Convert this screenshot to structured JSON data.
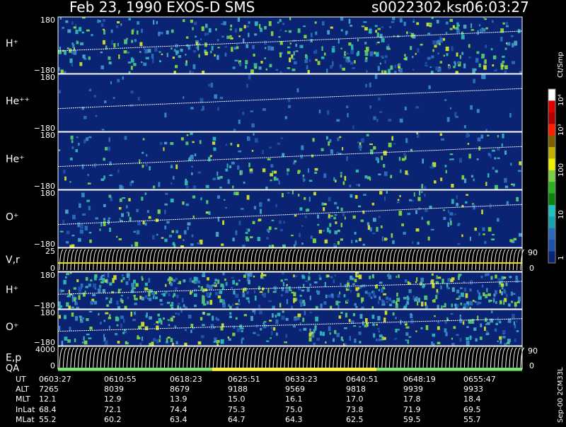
{
  "header": {
    "title": "Feb 23, 1990   EXOS-D SMS",
    "file": "s0022302.ksr",
    "time": "06:03:27"
  },
  "colors": {
    "background": "#000000",
    "panel_base": "#0a2473",
    "grid_line": "#ffffff",
    "qa_green": "#44c83a",
    "qa_yellow": "#f0e000"
  },
  "chart_data": {
    "type": "heatmap",
    "title": "Feb 23, 1990   EXOS-D SMS",
    "colorbar": {
      "label": "Ct/Smp",
      "tick_labels": [
        "10⁴",
        "10³",
        "100",
        "10",
        "1"
      ]
    },
    "panels": [
      {
        "id": "h-plus-1",
        "label": "H⁺",
        "y_top": "180",
        "y_bottom": "−180",
        "activity": 0.7
      },
      {
        "id": "he-plus-plus",
        "label": "He⁺⁺",
        "y_top": "180",
        "y_bottom": "−180",
        "activity": 0.05
      },
      {
        "id": "he-plus",
        "label": "He⁺",
        "y_top": "180",
        "y_bottom": "−180",
        "activity": 0.35
      },
      {
        "id": "o-plus-1",
        "label": "O⁺",
        "y_top": "180",
        "y_bottom": "−180",
        "activity": 0.4
      },
      {
        "id": "v-r",
        "label": "V,r",
        "y_top": "25",
        "y_bottom": "0",
        "right_top": "90",
        "right_bottom": "0",
        "activity": 0
      },
      {
        "id": "h-plus-2",
        "label": "H⁺",
        "y_top": "180",
        "y_bottom": "−180",
        "activity": 0.8
      },
      {
        "id": "o-plus-2",
        "label": "O⁺",
        "y_top": "180",
        "y_bottom": "−180",
        "activity": 0.45
      },
      {
        "id": "e-p",
        "label": "E,p",
        "sublabel": "QA",
        "y_top": "4000",
        "y_bottom": "0",
        "right_top": "90",
        "right_bottom": "0",
        "activity": 0
      }
    ],
    "x_axis": {
      "rows": [
        {
          "name": "UT",
          "values": [
            "0603:27",
            "0610:55",
            "0618:23",
            "0625:51",
            "0633:23",
            "0640:51",
            "0648:19",
            "0655:47"
          ]
        },
        {
          "name": "ALT",
          "values": [
            "7265",
            "8039",
            "8679",
            "9188",
            "9569",
            "9818",
            "9939",
            "9933"
          ]
        },
        {
          "name": "MLT",
          "values": [
            "12.1",
            "12.9",
            "13.9",
            "15.0",
            "16.1",
            "17.0",
            "17.8",
            "18.4"
          ]
        },
        {
          "name": "InLat",
          "values": [
            "68.4",
            "72.1",
            "74.4",
            "75.3",
            "75.0",
            "73.8",
            "71.9",
            "69.5"
          ]
        },
        {
          "name": "MLat",
          "values": [
            "55.2",
            "60.2",
            "63.4",
            "64.7",
            "64.3",
            "62.5",
            "59.5",
            "55.7"
          ]
        }
      ]
    }
  },
  "footer": {
    "version_tag": "Sep-00  2CM33L"
  }
}
